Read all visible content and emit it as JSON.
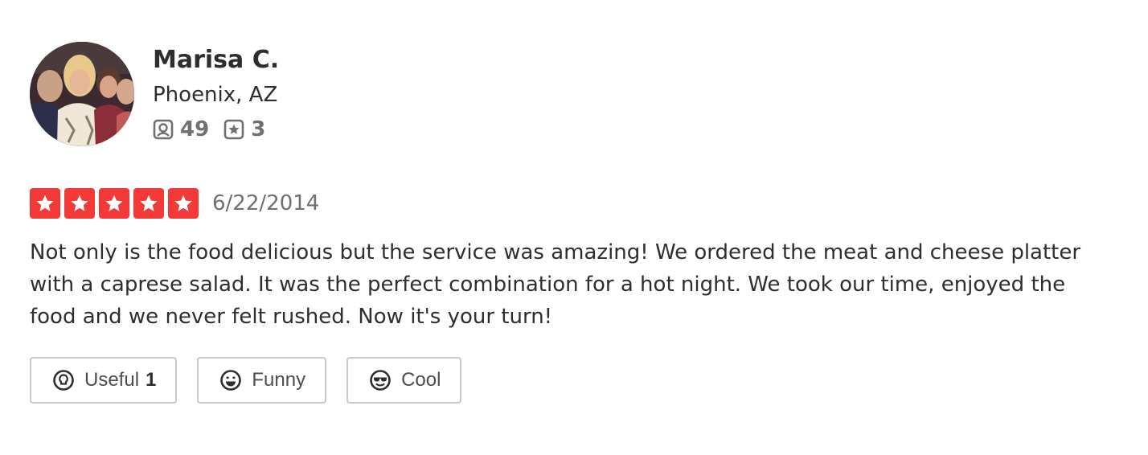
{
  "user": {
    "name": "Marisa C.",
    "location": "Phoenix, AZ",
    "review_count": "49",
    "photo_count": "3"
  },
  "review": {
    "rating": 5,
    "rating_max": 5,
    "date": "6/22/2014",
    "text": "Not only is the food delicious but the service was amazing! We ordered the meat and cheese platter with a caprese salad. It was the perfect combination for a hot night. We took our time, enjoyed the food and we never felt rushed. Now it's your turn!"
  },
  "reactions": {
    "useful_label": "Useful",
    "useful_count": "1",
    "funny_label": "Funny",
    "cool_label": "Cool"
  },
  "icons": {
    "review_count": "review-icon",
    "photo_count": "star-badge-icon",
    "useful": "lightbulb-icon",
    "funny": "smile-icon",
    "cool": "sunglasses-icon",
    "rating_star": "star-icon"
  },
  "colors": {
    "star_fill": "#f43939",
    "text": "#2d2e2f",
    "muted": "#6e7072",
    "button_border": "#c8c9ca"
  }
}
